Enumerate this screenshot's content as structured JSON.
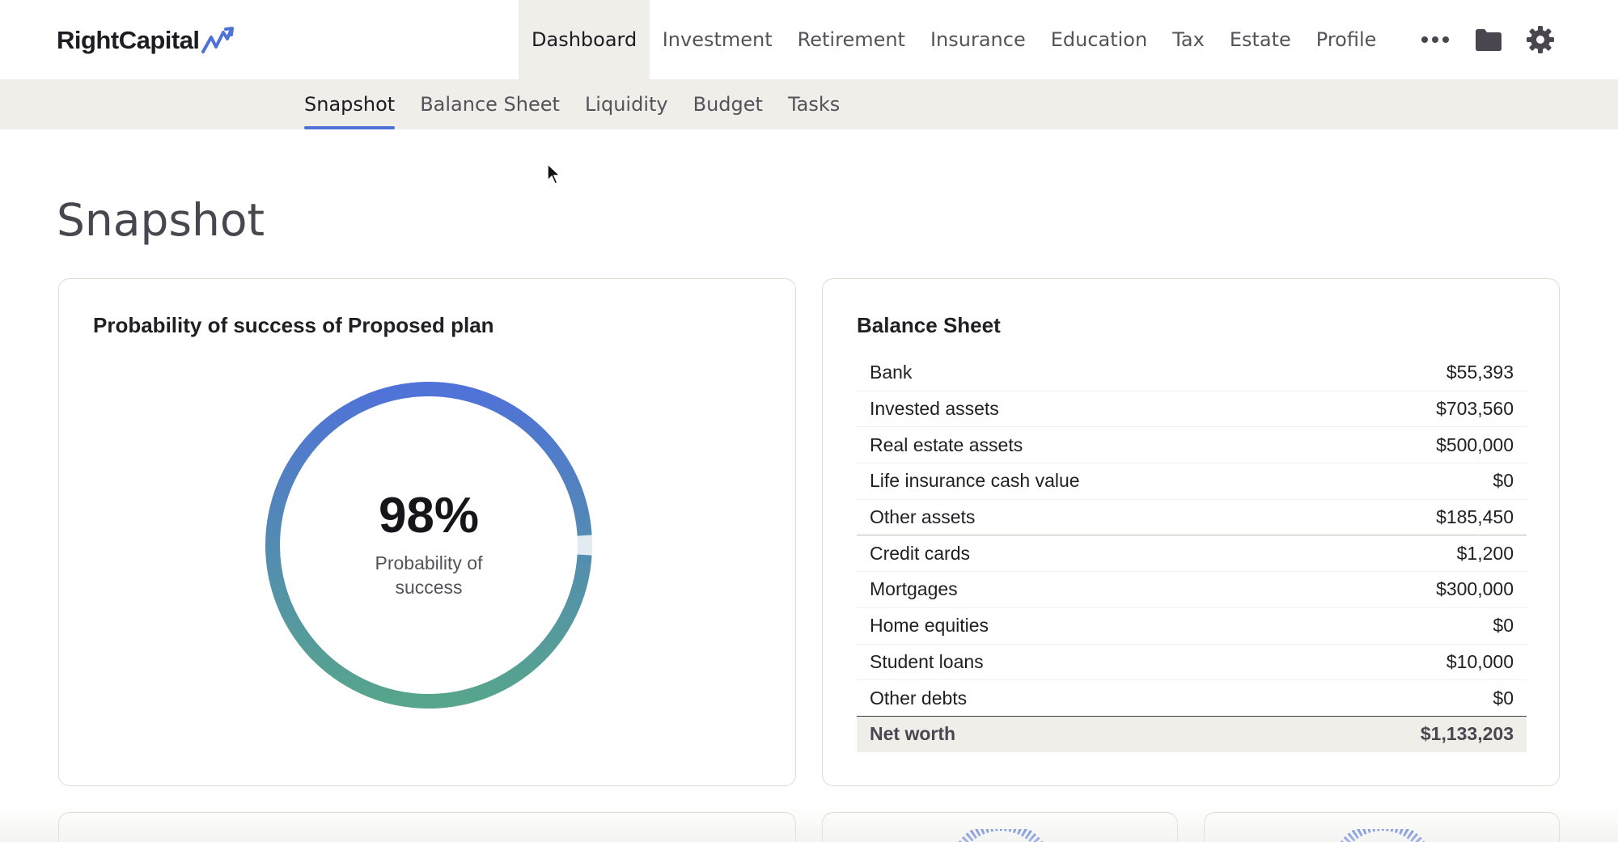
{
  "brand": {
    "name": "RightCapital",
    "accent": "#4f72d8"
  },
  "nav": {
    "items": [
      "Dashboard",
      "Investment",
      "Retirement",
      "Insurance",
      "Education",
      "Tax",
      "Estate",
      "Profile"
    ],
    "active": "Dashboard",
    "icons": [
      "more-icon",
      "folder-icon",
      "gear-icon"
    ]
  },
  "subnav": {
    "items": [
      "Snapshot",
      "Balance Sheet",
      "Liquidity",
      "Budget",
      "Tasks"
    ],
    "active": "Snapshot"
  },
  "page": {
    "title": "Snapshot"
  },
  "probability": {
    "title": "Probability of success of Proposed plan",
    "value": "98%",
    "fraction": 0.98,
    "label": "Probability of success",
    "gradient_top": "#4f72d8",
    "gradient_bottom": "#57a58c"
  },
  "balance_sheet": {
    "title": "Balance Sheet",
    "assets": [
      {
        "label": "Bank",
        "value": "$55,393"
      },
      {
        "label": "Invested assets",
        "value": "$703,560"
      },
      {
        "label": "Real estate assets",
        "value": "$500,000"
      },
      {
        "label": "Life insurance cash value",
        "value": "$0"
      },
      {
        "label": "Other assets",
        "value": "$185,450"
      }
    ],
    "liabilities": [
      {
        "label": "Credit cards",
        "value": "$1,200"
      },
      {
        "label": "Mortgages",
        "value": "$300,000"
      },
      {
        "label": "Home equities",
        "value": "$0"
      },
      {
        "label": "Student loans",
        "value": "$10,000"
      },
      {
        "label": "Other debts",
        "value": "$0"
      }
    ],
    "net_worth": {
      "label": "Net worth",
      "value": "$1,133,203"
    }
  }
}
